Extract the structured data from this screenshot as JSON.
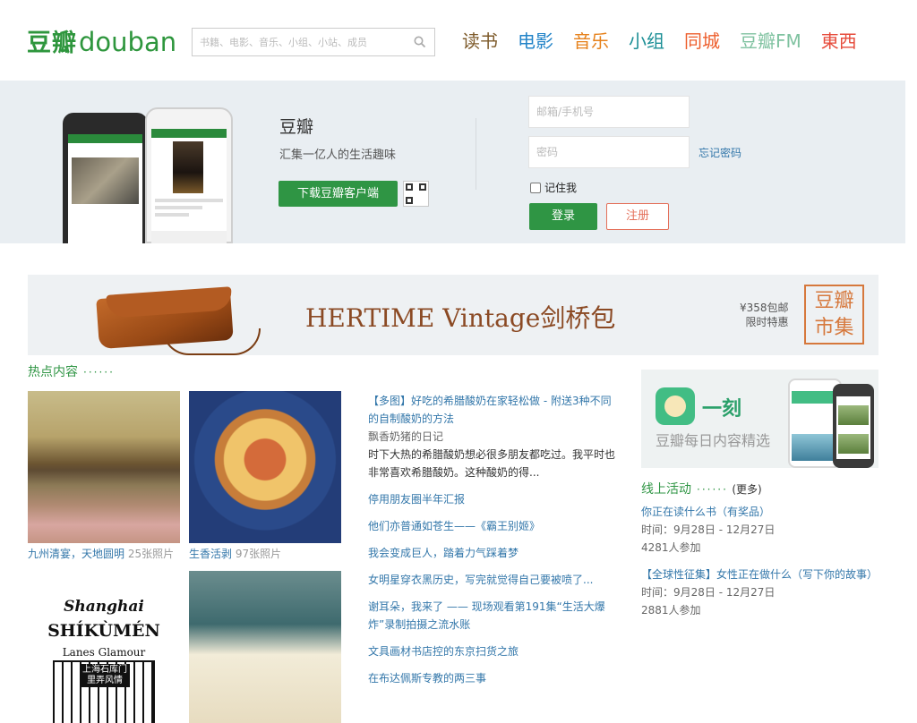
{
  "header": {
    "logo_cn": "豆瓣",
    "logo_en": "douban",
    "search_placeholder": "书籍、电影、音乐、小组、小站、成员",
    "nav": [
      {
        "label": "读书",
        "color": "#7d5a2a"
      },
      {
        "label": "电影",
        "color": "#2384c8"
      },
      {
        "label": "音乐",
        "color": "#e6811b"
      },
      {
        "label": "小组",
        "color": "#1c8f96"
      },
      {
        "label": "同城",
        "color": "#ed5d2b"
      },
      {
        "label": "豆瓣FM",
        "color": "#7fc2a0"
      },
      {
        "label": "東西",
        "color": "#e64b3b"
      }
    ]
  },
  "intro": {
    "title": "豆瓣",
    "slogan": "汇集一亿人的生活趣味",
    "download_label": "下载豆瓣客户端"
  },
  "login": {
    "account_placeholder": "邮箱/手机号",
    "password_placeholder": "密码",
    "forgot_label": "忘记密码",
    "remember_label": "记住我",
    "login_label": "登录",
    "register_label": "注册"
  },
  "ad": {
    "title": "HERTIME Vintage剑桥包",
    "price": "¥358包邮",
    "sale": "限时特惠",
    "stamp_line1": "豆瓣",
    "stamp_line2": "市集"
  },
  "hot": {
    "title": "热点内容",
    "dots": "······",
    "tiles": [
      {
        "title": "九州清宴，天地圆明",
        "count": "25张照片"
      },
      {
        "title": "生香活剥",
        "count": "97张照片"
      },
      {
        "title": "",
        "count": "",
        "shanghai": {
          "line1": "Shanghai",
          "line2": "SHÍKÙMÉN",
          "line3": "Lanes Glamour",
          "sign": "上海石库门 里弄风情"
        }
      },
      {
        "title": "",
        "count": ""
      }
    ],
    "feed_lead": {
      "title": "【多图】好吃的希腊酸奶在家轻松做 - 附送3种不同的自制酸奶的方法",
      "author": "飘香奶猪的日记",
      "summary": "时下大热的希腊酸奶想必很多朋友都吃过。我平时也非常喜欢希腊酸奶。这种酸奶的得..."
    },
    "feed_items": [
      "停用朋友圈半年汇报",
      "他们亦普通如苍生——《霸王别姬》",
      "我会变成巨人，踏着力气踩着梦",
      "女明星穿衣黑历史，写完就觉得自己要被喷了...",
      "谢耳朵，我来了 ——  现场观看第191集“生活大爆炸”录制拍摄之流水账",
      "文具画材书店控的东京扫货之旅",
      "在布达佩斯专教的两三事"
    ]
  },
  "yike": {
    "name": "一刻",
    "desc": "豆瓣每日内容精选"
  },
  "events": {
    "title": "线上活动",
    "dots": "······",
    "more": "(更多)",
    "items": [
      {
        "title": "你正在读什么书（有奖品）",
        "time": "时间：9月28日 - 12月27日",
        "count": "4281人参加"
      },
      {
        "title": "【全球性征集】女性正在做什么（写下你的故事）",
        "time": "时间：9月28日 - 12月27日",
        "count": "2881人参加"
      }
    ]
  }
}
